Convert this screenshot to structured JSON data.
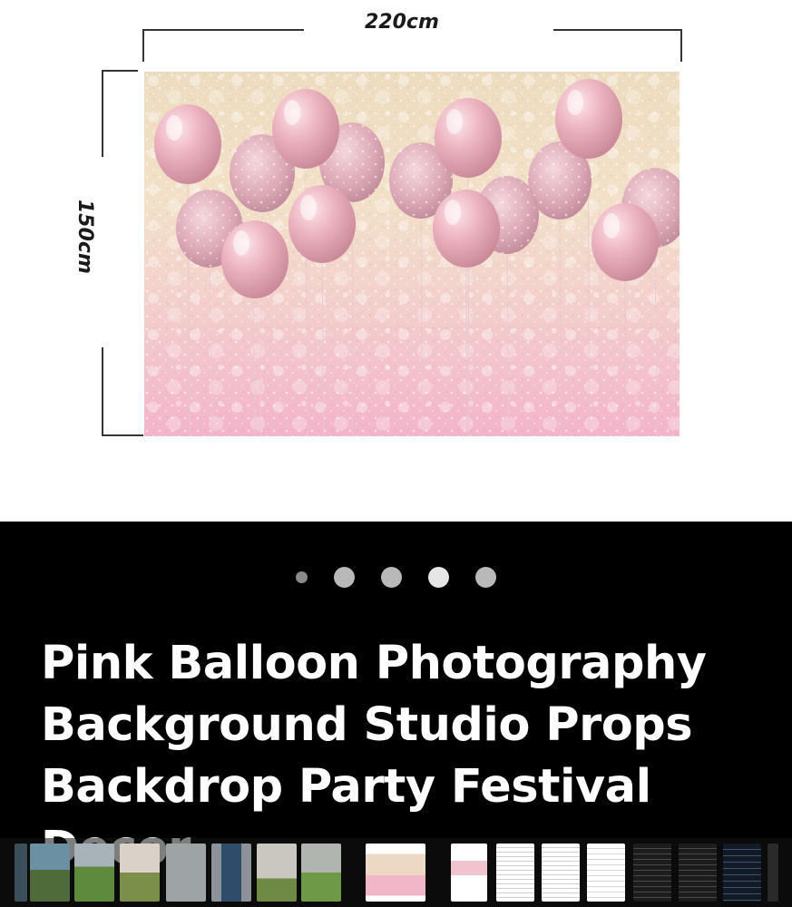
{
  "dimensions": {
    "width_label": "220cm",
    "height_label": "150cm"
  },
  "carousel": {
    "total_dots": 5,
    "active_index": 3
  },
  "product": {
    "title": "Pink Balloon Photography Background Studio Props Backdrop Party Festival Decor"
  },
  "thumbnails": [
    {
      "name": "house-photo-1"
    },
    {
      "name": "house-photo-2"
    },
    {
      "name": "house-photo-3"
    },
    {
      "name": "house-photo-4"
    },
    {
      "name": "house-photo-5"
    },
    {
      "name": "house-photo-6"
    },
    {
      "name": "house-photo-7"
    },
    {
      "name": "backdrop-product"
    },
    {
      "name": "product-page-1"
    },
    {
      "name": "product-page-2"
    },
    {
      "name": "product-page-3"
    },
    {
      "name": "product-page-4"
    },
    {
      "name": "dark-page-1"
    },
    {
      "name": "dark-page-2"
    },
    {
      "name": "dark-page-3"
    }
  ],
  "colors": {
    "background": "#000000",
    "title": "#ffffff",
    "balloon": "#f2b8c6",
    "glitter_top": "#efd9b6",
    "glitter_bottom": "#f4b9cc"
  }
}
